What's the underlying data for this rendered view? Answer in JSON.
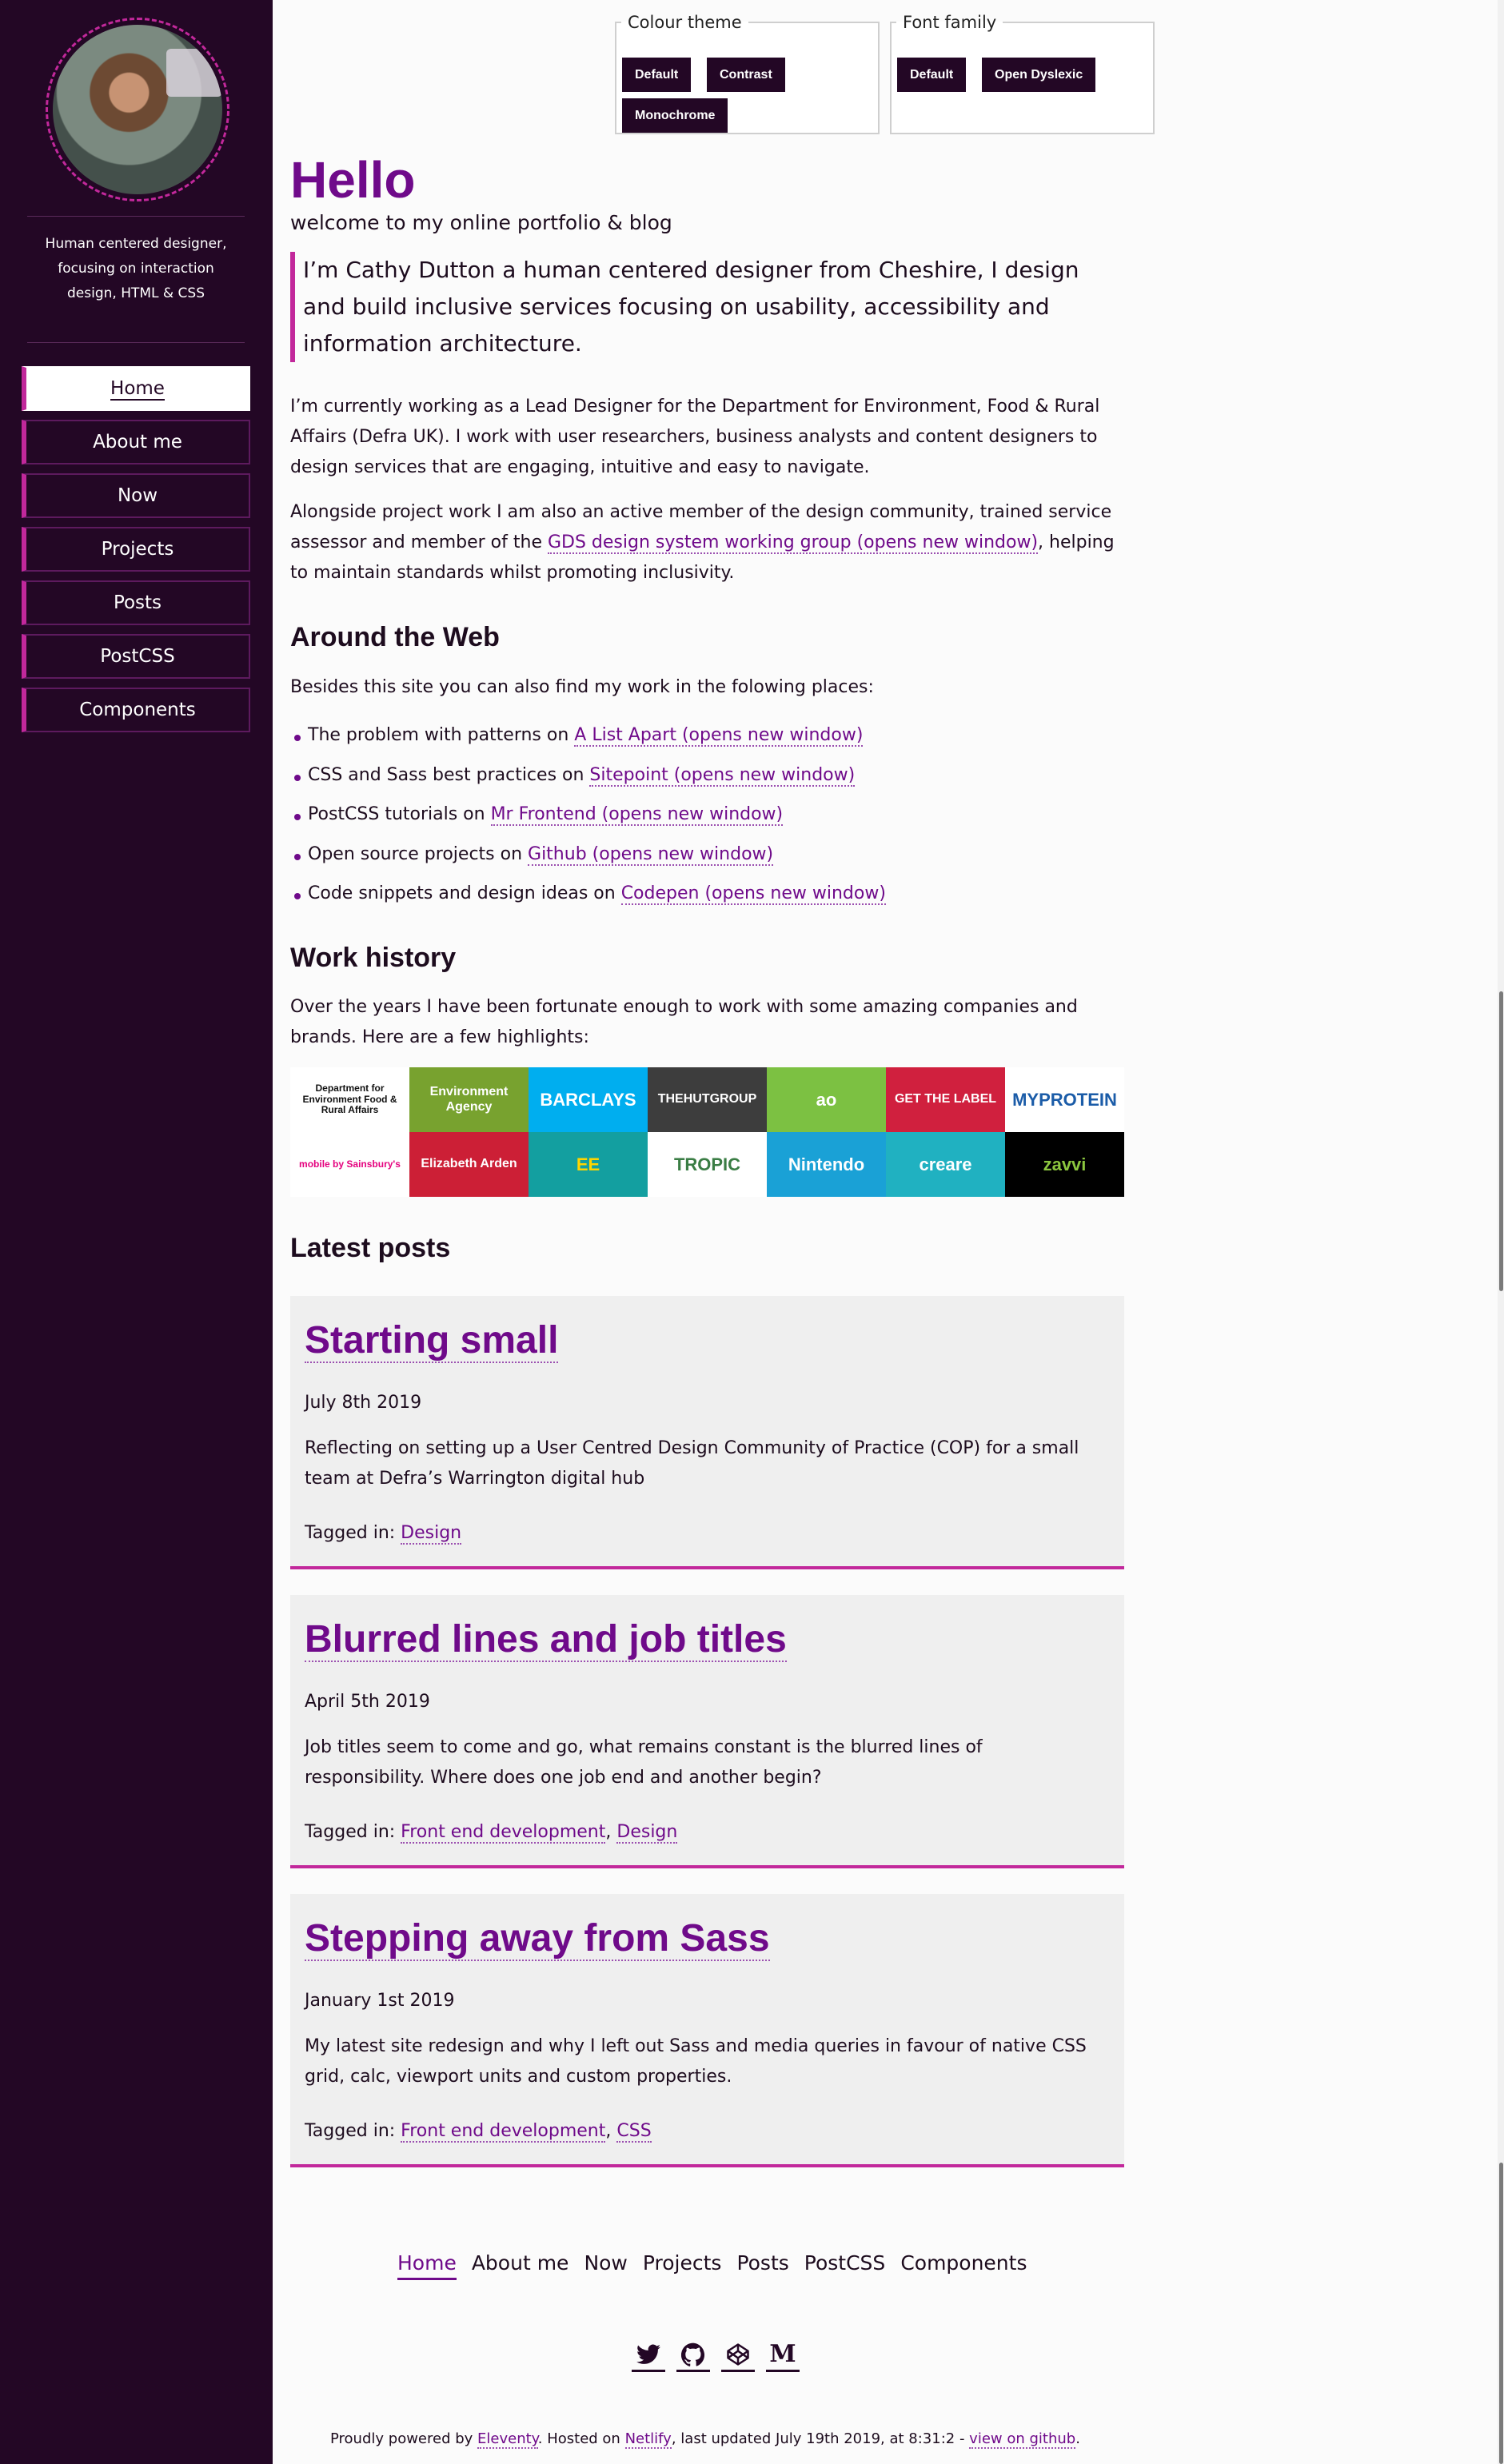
{
  "sidebar": {
    "tagline": "Human centered designer, focusing on interaction design, HTML & CSS",
    "nav": [
      {
        "label": "Home"
      },
      {
        "label": "About me"
      },
      {
        "label": "Now"
      },
      {
        "label": "Projects"
      },
      {
        "label": "Posts"
      },
      {
        "label": "PostCSS"
      },
      {
        "label": "Components"
      }
    ]
  },
  "theme": {
    "colour_legend": "Colour theme",
    "colour_options": [
      "Default",
      "Contrast",
      "Monochrome"
    ],
    "font_legend": "Font family",
    "font_options": [
      "Default",
      "Open Dyslexic"
    ]
  },
  "hero": {
    "title": "Hello",
    "subtitle": "welcome to my online portfolio & blog",
    "intro": "I’m Cathy Dutton a human centered designer from Cheshire, I design and build inclusive services focusing on usability, accessibility and information architecture."
  },
  "about": {
    "p1": "I’m currently working as a Lead Designer for the Department for Environment, Food & Rural Affairs (Defra UK). I work with user researchers, business analysts and content designers to design services that are engaging, intuitive and easy to navigate.",
    "p2_before": "Alongside project work I am also an active member of the design community, trained service assessor and member of the ",
    "p2_link": "GDS design system working group (opens new window)",
    "p2_after": ", helping to maintain standards whilst promoting inclusivity."
  },
  "web": {
    "heading": "Around the Web",
    "intro": "Besides this site you can also find my work in the folowing places:",
    "items": [
      {
        "text": "The problem with patterns on ",
        "link": "A List Apart (opens new window)"
      },
      {
        "text": "CSS and Sass best practices on ",
        "link": "Sitepoint (opens new window)"
      },
      {
        "text": "PostCSS tutorials on ",
        "link": "Mr Frontend (opens new window)"
      },
      {
        "text": "Open source projects on ",
        "link": "Github (opens new window)"
      },
      {
        "text": "Code snippets and design ideas on ",
        "link": "Codepen (opens new window)"
      }
    ]
  },
  "work": {
    "heading": "Work history",
    "intro": "Over the years I have been fortunate enough to work with some amazing companies and brands. Here are a few highlights:",
    "logos": [
      {
        "text": "Department for Environment Food & Rural Affairs",
        "bg": "#ffffff",
        "fg": "#111111"
      },
      {
        "text": "Environment Agency",
        "bg": "#78a22f",
        "fg": "#ffffff"
      },
      {
        "text": "BARCLAYS",
        "bg": "#00aeef",
        "fg": "#ffffff"
      },
      {
        "text": "THEHUTGROUP",
        "bg": "#3d3d3d",
        "fg": "#ffffff"
      },
      {
        "text": "ao",
        "bg": "#7cc142",
        "fg": "#ffffff"
      },
      {
        "text": "GET THE LABEL",
        "bg": "#d0203e",
        "fg": "#ffffff"
      },
      {
        "text": "MYPROTEIN",
        "bg": "#ffffff",
        "fg": "#1b5ca8"
      },
      {
        "text": "mobile by Sainsbury's",
        "bg": "#ffffff",
        "fg": "#e5007e"
      },
      {
        "text": "Elizabeth Arden",
        "bg": "#cc1f36",
        "fg": "#ffffff"
      },
      {
        "text": "EE",
        "bg": "#139fa0",
        "fg": "#ffd500"
      },
      {
        "text": "TROPIC",
        "bg": "#ffffff",
        "fg": "#3a7d44"
      },
      {
        "text": "Nintendo",
        "bg": "#1aa1d6",
        "fg": "#ffffff"
      },
      {
        "text": "creare",
        "bg": "#20b1c1",
        "fg": "#ffffff"
      },
      {
        "text": "zavvi",
        "bg": "#000000",
        "fg": "#8cc63f"
      }
    ]
  },
  "posts": {
    "heading": "Latest posts",
    "tagged_label": "Tagged in: ",
    "items": [
      {
        "title": "Starting small",
        "date": "July 8th 2019",
        "excerpt": "Reflecting on setting up a User Centred Design Community of Practice (COP) for a small team at Defra’s Warrington digital hub",
        "tags": [
          "Design"
        ]
      },
      {
        "title": "Blurred lines and job titles",
        "date": "April 5th 2019",
        "excerpt": "Job titles seem to come and go, what remains constant is the blurred lines of responsibility. Where does one job end and another begin?",
        "tags": [
          "Front end development",
          "Design"
        ]
      },
      {
        "title": "Stepping away from Sass",
        "date": "January 1st 2019",
        "excerpt": "My latest site redesign and why I left out Sass and media queries in favour of native CSS grid, calc, viewport units and custom properties.",
        "tags": [
          "Front end development",
          "CSS"
        ]
      }
    ]
  },
  "footer": {
    "nav": [
      "Home",
      "About me",
      "Now",
      "Projects",
      "Posts",
      "PostCSS",
      "Components"
    ],
    "social": [
      "twitter-icon",
      "github-icon",
      "codepen-icon",
      "medium-icon"
    ],
    "credits_1": "Proudly powered by ",
    "credits_link1": "Eleventy",
    "credits_2": ". Hosted on ",
    "credits_link2": "Netlify",
    "credits_3": ", last updated July 19th 2019, at 8:31:2 - ",
    "credits_link3": "view on github",
    "credits_4": "."
  }
}
